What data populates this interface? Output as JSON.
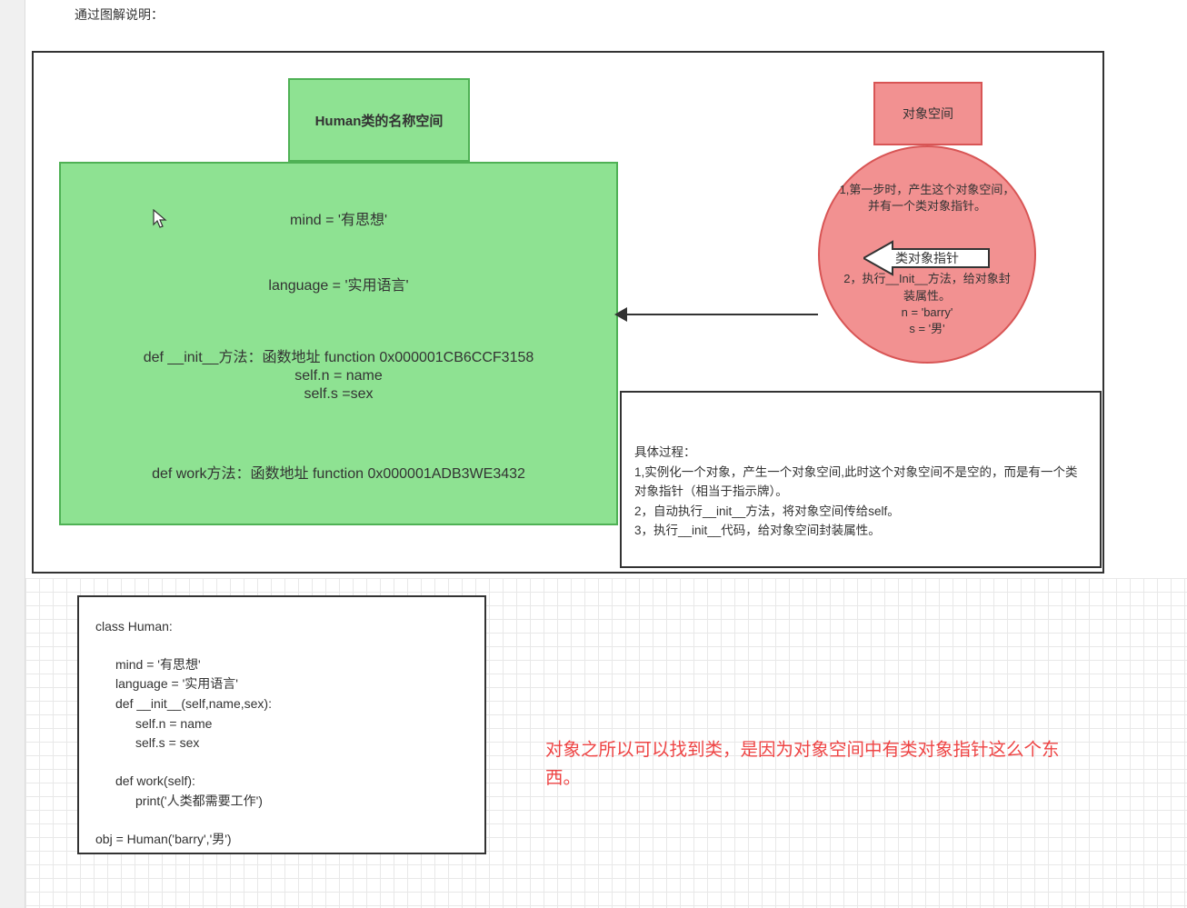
{
  "heading": "通过图解说明：",
  "namespace": {
    "tab": "Human类的名称空间",
    "line1": "mind = '有思想'",
    "line2": "language = '实用语言'",
    "line3": "def __init__方法：函数地址 function 0x000001CB6CCF3158",
    "line4": "self.n = name",
    "line5": "self.s =sex",
    "line6": "def work方法：函数地址 function 0x000001ADB3WE3432"
  },
  "object_space": {
    "tab": "对象空间",
    "top": "1,第一步时，产生这个对象空间，并有一个类对象指针。",
    "pointer_label": "类对象指针",
    "mid_l1": "2，执行__Init__方法，给对象封装属性。",
    "mid_l2": "n = 'barry'",
    "mid_l3": "s = '男'"
  },
  "process": {
    "title": "具体过程：",
    "line1": "1,实例化一个对象，产生一个对象空间,此时这个对象空间不是空的，而是有一个类对象指针（相当于指示牌）。",
    "line2": "2，自动执行__init__方法，将对象空间传给self。",
    "line3": "3，执行__init__代码，给对象空间封装属性。"
  },
  "code": {
    "l1": "class Human:",
    "l2": "mind = '有思想'",
    "l3": "language = '实用语言'",
    "l4": "def __init__(self,name,sex):",
    "l5": "self.n = name",
    "l6": "self.s = sex",
    "l7": "def work(self):",
    "l8": "print('人类都需要工作')",
    "l9": "obj = Human('barry','男')"
  },
  "highlight": "对象之所以可以找到类，是因为对象空间中有类对象指针这么个东西。"
}
